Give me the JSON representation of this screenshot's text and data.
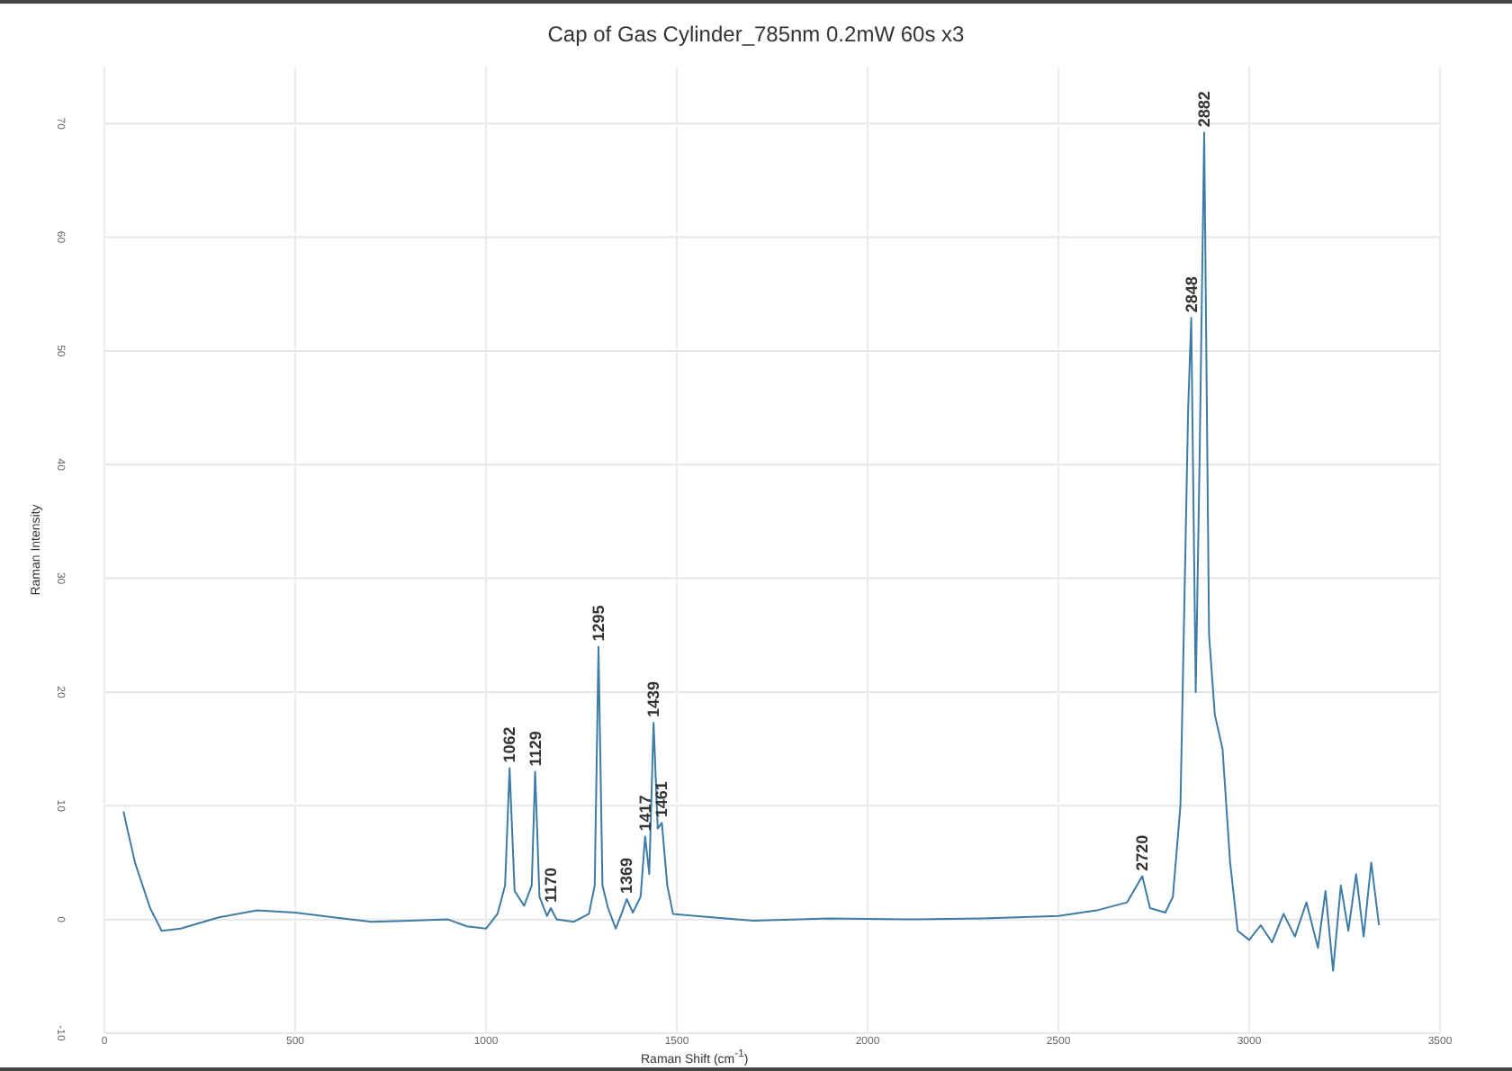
{
  "chart": {
    "chart_data": {
      "type": "line",
      "title": "Cap of Gas Cylinder_785nm 0.2mW 60s x3",
      "xlabel": "Raman Shift (cm$^{-1}$)",
      "ylabel": "Raman Intensity",
      "x": [
        50,
        60,
        80,
        100,
        120,
        150,
        200,
        300,
        400,
        500,
        600,
        700,
        800,
        900,
        950,
        1000,
        1030,
        1050,
        1062,
        1075,
        1100,
        1120,
        1129,
        1140,
        1160,
        1170,
        1185,
        1230,
        1270,
        1285,
        1295,
        1305,
        1320,
        1340,
        1355,
        1369,
        1385,
        1405,
        1417,
        1428,
        1439,
        1450,
        1461,
        1475,
        1490,
        1550,
        1700,
        1900,
        2100,
        2300,
        2500,
        2600,
        2680,
        2720,
        2740,
        2780,
        2800,
        2820,
        2840,
        2848,
        2860,
        2870,
        2882,
        2895,
        2910,
        2930,
        2950,
        2970,
        3000,
        3030,
        3060,
        3090,
        3120,
        3150,
        3180,
        3200,
        3220,
        3240,
        3260,
        3280,
        3300,
        3320,
        3340
      ],
      "series": [
        {
          "color": "#3e7ca6",
          "values": [
            9.5,
            8,
            5,
            3,
            1,
            -1,
            -0.8,
            0.2,
            0.8,
            0.6,
            0.2,
            -0.2,
            -0.1,
            0,
            -0.6,
            -0.8,
            0.5,
            3,
            13.3,
            2.5,
            1.2,
            3,
            13,
            2,
            0.3,
            1,
            0,
            -0.2,
            0.5,
            3,
            24,
            3,
            1,
            -0.8,
            0.5,
            1.8,
            0.6,
            2,
            7.3,
            4,
            17.3,
            8,
            8.5,
            3,
            0.5,
            0.3,
            -0.1,
            0.1,
            0,
            0.1,
            0.3,
            0.8,
            1.5,
            3.8,
            1,
            0.6,
            2,
            10,
            45,
            52.9,
            20,
            40,
            69.2,
            25,
            18,
            15,
            5,
            -1,
            -1.8,
            -0.5,
            -2,
            0.5,
            -1.5,
            1.5,
            -2.5,
            2.5,
            -4.5,
            3,
            -1,
            4,
            -1.5,
            5,
            -0.5
          ]
        }
      ],
      "grid": true,
      "xlim": [
        0,
        3500
      ],
      "ylim": [
        -10,
        75
      ],
      "xticks": [
        0,
        500,
        1000,
        1500,
        2000,
        2500,
        3000,
        3500
      ],
      "yticks": [
        -10,
        0,
        10,
        20,
        30,
        40,
        50,
        60,
        70
      ],
      "annotations": [
        {
          "x": 1062,
          "y": 13.3,
          "text": "1062"
        },
        {
          "x": 1129,
          "y": 13,
          "text": "1129"
        },
        {
          "x": 1170,
          "y": 1,
          "text": "1170"
        },
        {
          "x": 1295,
          "y": 24,
          "text": "1295"
        },
        {
          "x": 1369,
          "y": 1.8,
          "text": "1369"
        },
        {
          "x": 1417,
          "y": 7.3,
          "text": "1417"
        },
        {
          "x": 1439,
          "y": 17.3,
          "text": "1439"
        },
        {
          "x": 1461,
          "y": 8.5,
          "text": "1461"
        },
        {
          "x": 2720,
          "y": 3.8,
          "text": "2720"
        },
        {
          "x": 2848,
          "y": 52.9,
          "text": "2848"
        },
        {
          "x": 2882,
          "y": 69.2,
          "text": "2882"
        }
      ]
    }
  }
}
